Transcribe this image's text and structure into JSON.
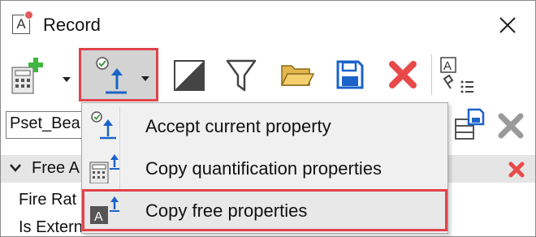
{
  "window": {
    "title": "Record"
  },
  "toolbar": {
    "add_icon": "calculator-add-icon",
    "accept_icon": "accept-property-icon",
    "items": [
      "color-picker-icon",
      "filter-icon",
      "open-folder-icon",
      "save-icon",
      "delete-icon",
      "free-properties-list-icon"
    ]
  },
  "pset": {
    "value": "Pset_Bea"
  },
  "group": {
    "label": "Free A"
  },
  "properties": [
    {
      "label": "Fire Rat"
    },
    {
      "label": "Is Externa"
    }
  ],
  "menu": {
    "items": [
      {
        "label": "Accept current property",
        "icon": "accept-property-icon"
      },
      {
        "label": "Copy quantification properties",
        "icon": "calculator-copy-icon"
      },
      {
        "label": "Copy free properties",
        "icon": "free-property-copy-icon"
      }
    ]
  },
  "colors": {
    "highlight": "#e0434b",
    "accent_blue": "#1a63c9",
    "delete_red": "#e84a4a"
  }
}
